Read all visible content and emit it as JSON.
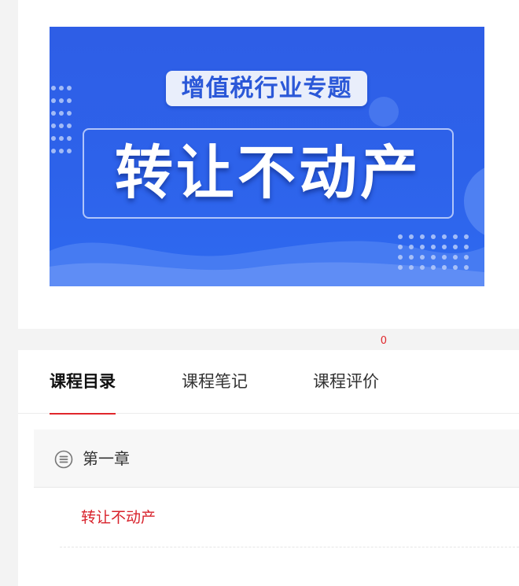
{
  "banner": {
    "tag": "增值税行业专题",
    "title": "转让不动产",
    "colors": {
      "background": "#2e5ee6",
      "tag_text": "#2b58d8"
    }
  },
  "tabs": [
    {
      "label": "课程目录",
      "active": true
    },
    {
      "label": "课程笔记",
      "active": false
    },
    {
      "label": "课程评价",
      "active": false,
      "badge": "0"
    }
  ],
  "chapter": {
    "label": "第一章",
    "icon": "list-circle-icon"
  },
  "lessons": [
    {
      "label": "转让不动产",
      "active": true
    }
  ],
  "colors": {
    "accent": "#e0262b",
    "page_bg": "#f3f3f3"
  }
}
